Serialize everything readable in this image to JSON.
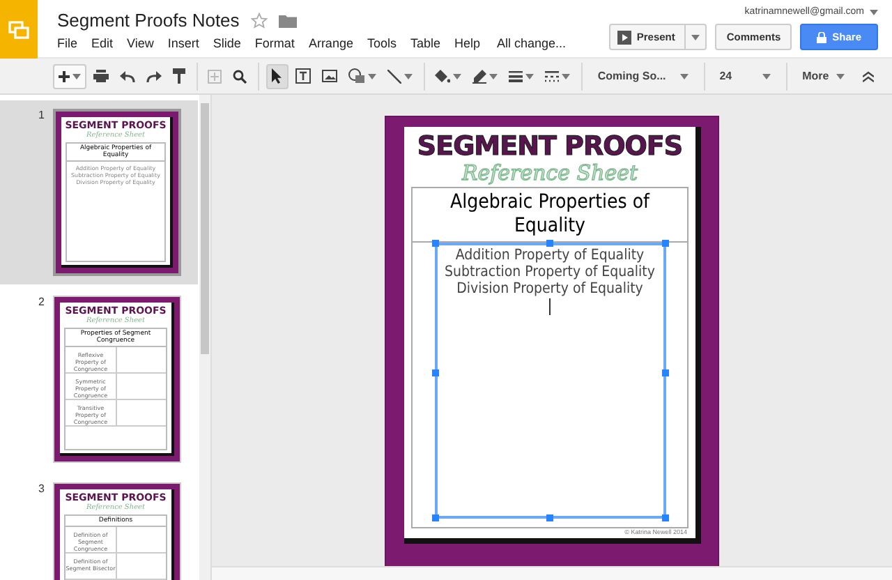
{
  "document": {
    "title": "Segment Proofs Notes"
  },
  "account": "katrinamnewell@gmail.com",
  "menu": [
    "File",
    "Edit",
    "View",
    "Insert",
    "Slide",
    "Format",
    "Arrange",
    "Tools",
    "Table",
    "Help"
  ],
  "save_status": "All change...",
  "buttons": {
    "present": "Present",
    "comments": "Comments",
    "share": "Share"
  },
  "toolbar": {
    "font": "Coming So...",
    "size": "24",
    "more": "More"
  },
  "slides": [
    {
      "number": "1",
      "selected": true,
      "kind": "list",
      "title": "SEGMENT PROOFS",
      "subtitle": "Reference Sheet",
      "heading": "Algebraic Properties of Equality",
      "lines": [
        "Addition Property of Equality",
        "Subtraction Property of Equality",
        "Division Property of Equality"
      ]
    },
    {
      "number": "2",
      "selected": false,
      "kind": "table",
      "title": "SEGMENT PROOFS",
      "subtitle": "Reference Sheet",
      "heading": "Properties of Segment Congruence",
      "rows": [
        "Reflexive Property of Congruence",
        "Symmetric Property of Congruence",
        "Transitive Property of Congruence"
      ]
    },
    {
      "number": "3",
      "selected": false,
      "kind": "table",
      "title": "SEGMENT PROOFS",
      "subtitle": "Reference Sheet",
      "heading": "Definitions",
      "rows": [
        "Definition of Segment Congruence",
        "Definition of Segment Bisector"
      ]
    }
  ],
  "canvas": {
    "title": "SEGMENT PROOFS",
    "subtitle": "Reference Sheet",
    "heading": "Algebraic Properties of Equality",
    "lines": [
      "Addition Property of Equality",
      "Subtraction Property of Equality",
      "Division Property of Equality"
    ],
    "footer": "© Katrina Newell 2014"
  }
}
